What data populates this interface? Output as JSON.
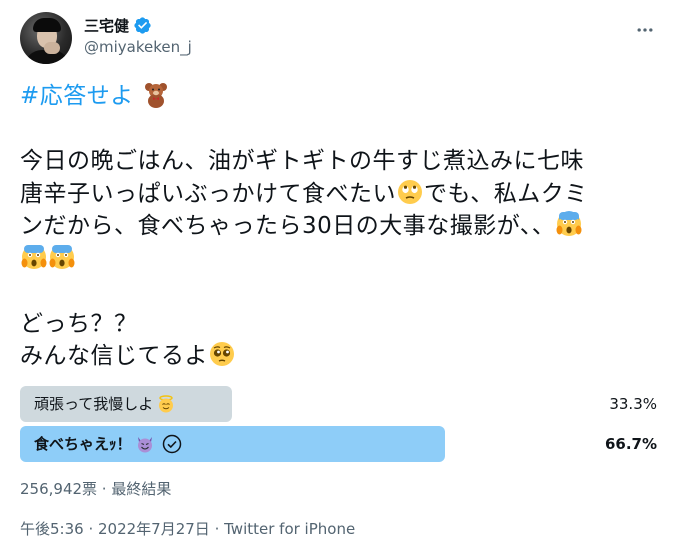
{
  "author": {
    "display_name": "三宅健",
    "handle": "@miyakeken_j",
    "verified": true
  },
  "tweet": {
    "hashtag": "#応答せよ",
    "lines": {
      "l1": "今日の晩ごはん、油がギトギトの牛すじ煮込みに七味",
      "l2": "唐辛子いっぱいぶっかけて食べたい",
      "l2b": "でも、私ムクミ",
      "l3": "ンだから、食べちゃったら30日の大事な撮影が、、",
      "l5": "どっち？？",
      "l6": "みんな信じてるよ"
    },
    "emojis": [
      "teddy-bear",
      "face-with-rolling-eyes",
      "face-screaming-in-fear",
      "face-screaming-in-fear",
      "face-screaming-in-fear",
      "pleading-face"
    ]
  },
  "poll": {
    "options": [
      {
        "label": "頑張って我慢しよ",
        "emoji": "smiling-face-with-halo",
        "percent": "33.3%",
        "fraction": 0.333,
        "winner": false
      },
      {
        "label": "食べちゃえｯ！",
        "emoji": "smiling-face-with-horns",
        "percent": "66.7%",
        "fraction": 0.667,
        "winner": true
      }
    ],
    "meta": "256,942票 · 最終結果"
  },
  "footer": {
    "time": "午後5:36",
    "sep": " · ",
    "date": "2022年7月27日",
    "source": "Twitter for iPhone"
  },
  "colors": {
    "accent": "#1d9bf0",
    "poll_lose": "#cfd9de",
    "poll_win": "#8ecdf8",
    "secondary_text": "#536471"
  }
}
